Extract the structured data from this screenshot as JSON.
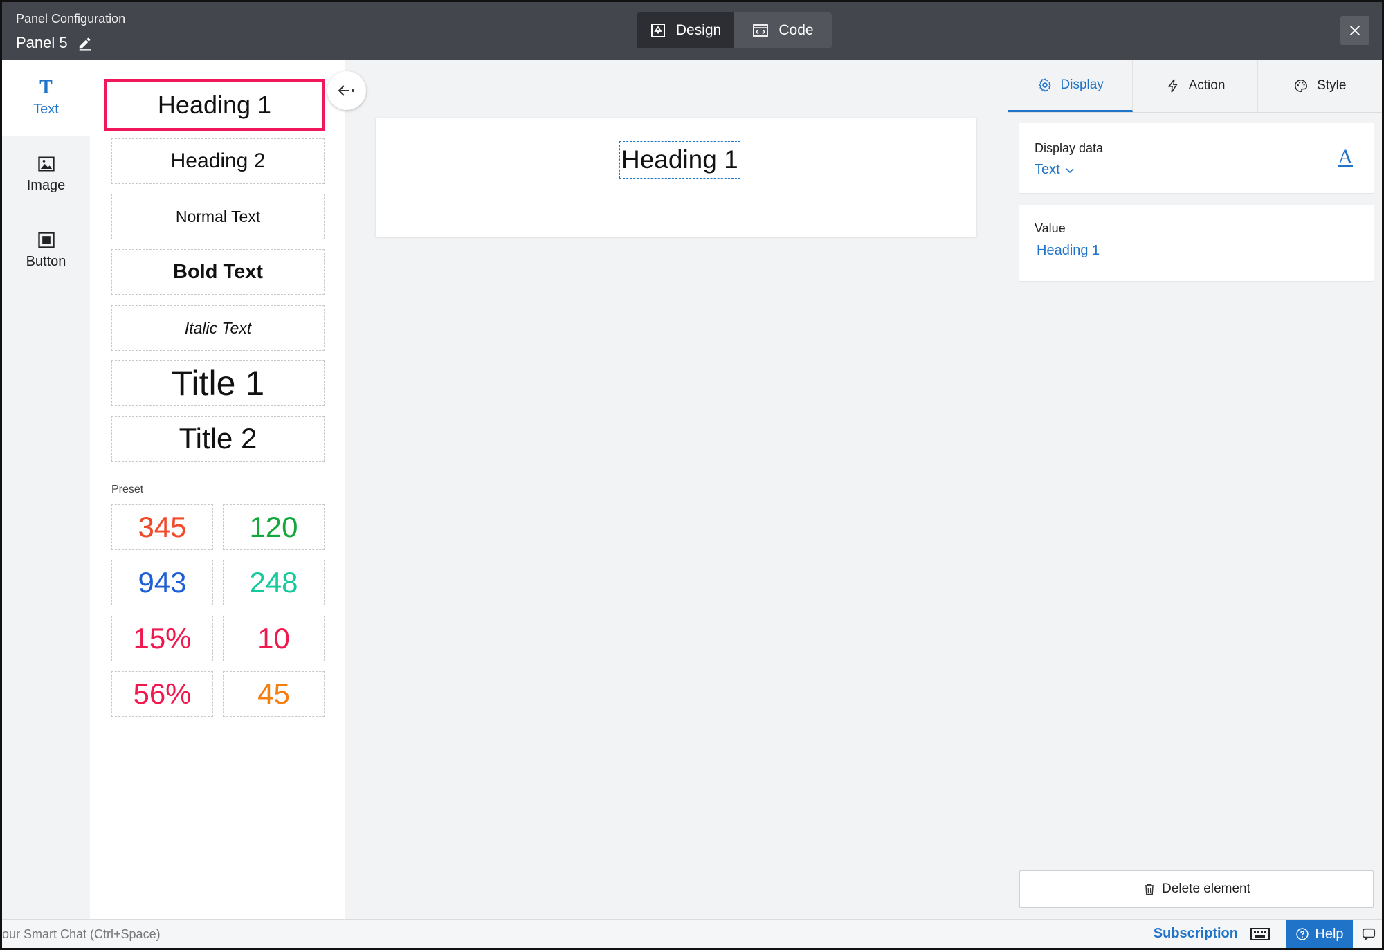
{
  "header": {
    "subtitle": "Panel Configuration",
    "panel_name": "Panel 5",
    "modes": [
      {
        "label": "Design",
        "active": true,
        "icon": "design-icon"
      },
      {
        "label": "Code",
        "active": false,
        "icon": "code-icon"
      }
    ],
    "close_icon": "close-icon"
  },
  "rail": {
    "items": [
      {
        "label": "Text",
        "glyph": "T",
        "icon": "text-icon",
        "active": true
      },
      {
        "label": "Image",
        "icon": "image-icon",
        "active": false
      },
      {
        "label": "Button",
        "icon": "button-icon",
        "active": false
      }
    ]
  },
  "components": {
    "items": [
      "Heading 1",
      "Heading 2",
      "Normal Text",
      "Bold Text",
      "Italic Text",
      "Title 1",
      "Title 2"
    ],
    "selected": "Heading 1",
    "preset_label": "Preset",
    "presets": [
      {
        "value": "345",
        "color": "#f04a2a"
      },
      {
        "value": "120",
        "color": "#13a83c"
      },
      {
        "value": "943",
        "color": "#1f5fd6"
      },
      {
        "value": "248",
        "color": "#14c99a"
      },
      {
        "value": "15%",
        "color": "#f0184d"
      },
      {
        "value": "10",
        "color": "#f0184d"
      },
      {
        "value": "56%",
        "color": "#f0184d"
      },
      {
        "value": "45",
        "color": "#f57e10"
      }
    ]
  },
  "canvas": {
    "heading": "Heading 1"
  },
  "props": {
    "tabs": [
      {
        "label": "Display",
        "icon": "gear-icon",
        "active": true
      },
      {
        "label": "Action",
        "icon": "bolt-icon",
        "active": false
      },
      {
        "label": "Style",
        "icon": "palette-icon",
        "active": false
      }
    ],
    "display_data_label": "Display data",
    "display_data_value": "Text",
    "font_glyph": "A",
    "value_label": "Value",
    "value_value": "Heading 1",
    "delete_label": "Delete element"
  },
  "bottom": {
    "chat_hint": "our Smart Chat (Ctrl+Space)",
    "subscription": "Subscription",
    "help": "Help"
  },
  "colors": {
    "accent": "#1f74c9",
    "selection": "#f0185a",
    "header_bg": "#43464d"
  }
}
